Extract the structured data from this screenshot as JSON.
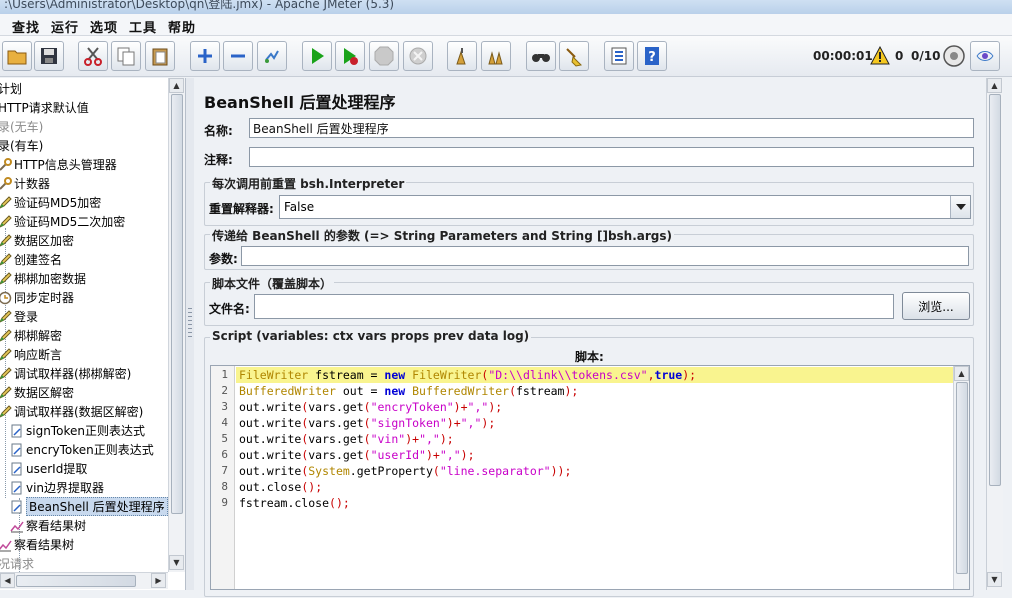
{
  "window": {
    "title": ":\\Users\\Administrator\\Desktop\\qn\\登陆.jmx) - Apache JMeter (5.3)"
  },
  "menu": {
    "items": [
      "查找",
      "运行",
      "选项",
      "工具",
      "帮助"
    ]
  },
  "toolbar": {
    "elapsed_time": "00:00:01",
    "warning_count": "0",
    "threads": "0/10",
    "buttons": [
      "open-icon",
      "save-icon",
      "cut-icon",
      "copy-icon",
      "paste-icon",
      "expand-icon",
      "collapse-icon",
      "toggle-icon",
      "start-icon",
      "start-no-pause-icon",
      "stop-icon",
      "shutdown-icon",
      "clear-icon",
      "clear-all-icon",
      "search-icon",
      "reset-search-icon",
      "function-helper-icon",
      "help-icon"
    ],
    "icon_colors": {
      "green": "#1aa31a",
      "blue": "#2a63c8",
      "red": "#c8202a"
    }
  },
  "tree": {
    "items": [
      {
        "label": "计划",
        "icon": "none",
        "gray": false
      },
      {
        "label": "HTTP请求默认值",
        "icon": "none",
        "gray": false
      },
      {
        "label": "录(无车)",
        "icon": "none",
        "gray": true
      },
      {
        "label": "录(有车)",
        "icon": "none",
        "gray": false
      },
      {
        "label": "HTTP信息头管理器",
        "icon": "wrench-icon",
        "gray": false
      },
      {
        "label": "计数器",
        "icon": "wrench-icon",
        "gray": false
      },
      {
        "label": "验证码MD5加密",
        "icon": "pencil-icon",
        "gray": false
      },
      {
        "label": "验证码MD5二次加密",
        "icon": "pencil-icon",
        "gray": false
      },
      {
        "label": "数据区加密",
        "icon": "pencil-icon",
        "gray": false
      },
      {
        "label": "创建签名",
        "icon": "pencil-icon",
        "gray": false
      },
      {
        "label": "梆梆加密数据",
        "icon": "pencil-icon",
        "gray": false
      },
      {
        "label": "同步定时器",
        "icon": "timer-icon",
        "gray": false
      },
      {
        "label": "登录",
        "icon": "pencil-icon",
        "gray": false
      },
      {
        "label": "梆梆解密",
        "icon": "pencil-icon",
        "gray": false
      },
      {
        "label": "响应断言",
        "icon": "pencil-icon",
        "gray": false
      },
      {
        "label": "调试取样器(梆梆解密)",
        "icon": "pencil-icon",
        "gray": false
      },
      {
        "label": "数据区解密",
        "icon": "pencil-icon",
        "gray": false
      },
      {
        "label": "调试取样器(数据区解密)",
        "icon": "pencil-icon",
        "gray": false
      },
      {
        "label": "signToken正则表达式",
        "icon": "extractor-icon",
        "gray": false
      },
      {
        "label": "encryToken正则表达式",
        "icon": "extractor-icon",
        "gray": false
      },
      {
        "label": "userId提取",
        "icon": "extractor-icon",
        "gray": false
      },
      {
        "label": "vin边界提取器",
        "icon": "extractor-icon",
        "gray": false
      },
      {
        "label": "BeanShell 后置处理程序",
        "icon": "extractor-icon",
        "gray": false,
        "selected": true
      },
      {
        "label": "察看结果树",
        "icon": "chart-icon",
        "gray": false
      },
      {
        "label": "察看结果树",
        "icon": "chart-icon",
        "gray": false
      },
      {
        "label": "况请求",
        "icon": "none",
        "gray": true
      }
    ]
  },
  "panel": {
    "title": "BeanShell 后置处理程序",
    "name_label": "名称:",
    "name_value": "BeanShell 后置处理程序",
    "comment_label": "注释:",
    "comment_value": "",
    "reset_group_title": "每次调用前重置 bsh.Interpreter",
    "reset_label": "重置解释器:",
    "reset_value": "False",
    "params_group_title": "传递给 BeanShell 的参数 (=> String Parameters and String []bsh.args)",
    "params_label": "参数:",
    "params_value": "",
    "file_group_title": "脚本文件（覆盖脚本）",
    "file_label": "文件名:",
    "file_value": "",
    "browse_label": "浏览...",
    "script_group_title": "Script (variables: ctx vars props prev data log)",
    "script_label": "脚本:"
  },
  "script": {
    "line_numbers": [
      "1",
      "2",
      "3",
      "4",
      "5",
      "6",
      "7",
      "8",
      "9"
    ],
    "lines": [
      "FileWriter fstream = new FileWriter(\"D:\\\\dlink\\\\tokens.csv\",true);",
      "BufferedWriter out = new BufferedWriter(fstream);",
      "out.write(vars.get(\"encryToken\")+\",\");",
      "out.write(vars.get(\"signToken\")+\",\");",
      "out.write(vars.get(\"vin\")+\",\");",
      "out.write(vars.get(\"userId\")+\",\");",
      "out.write(System.getProperty(\"line.separator\"));",
      "out.close();",
      "fstream.close();"
    ],
    "highlight_color": "#f9f48f"
  }
}
